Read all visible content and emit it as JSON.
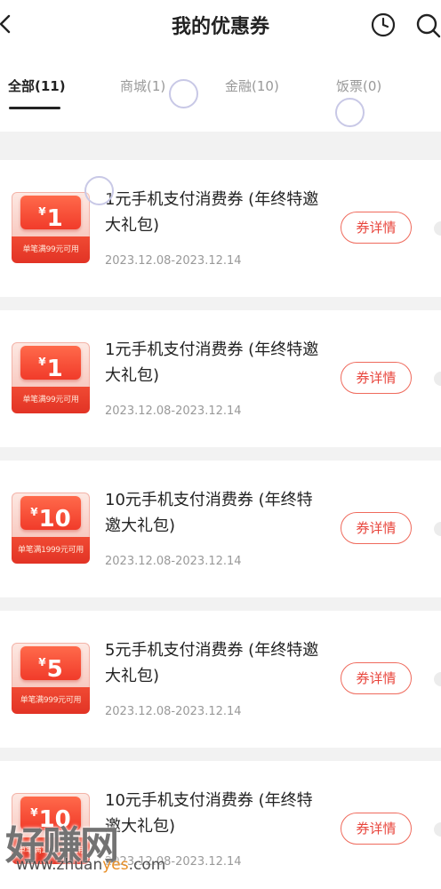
{
  "header": {
    "title": "我的优惠券",
    "back_icon": "chevron-left-icon",
    "history_icon": "clock-icon",
    "search_icon": "search-icon"
  },
  "tabs": [
    {
      "label": "全部(11)",
      "active": true
    },
    {
      "label": "商城(1)",
      "active": false
    },
    {
      "label": "金融(10)",
      "active": false
    },
    {
      "label": "饭票(0)",
      "active": false
    }
  ],
  "coupons": [
    {
      "amount": "1",
      "currency": "¥",
      "condition": "单笔满99元可用",
      "name": "1元手机支付消费券 (年终特邀大礼包)",
      "date": "2023.12.08-2023.12.14",
      "button": "券详情"
    },
    {
      "amount": "1",
      "currency": "¥",
      "condition": "单笔满99元可用",
      "name": "1元手机支付消费券 (年终特邀大礼包)",
      "date": "2023.12.08-2023.12.14",
      "button": "券详情"
    },
    {
      "amount": "10",
      "currency": "¥",
      "condition": "单笔满1999元可用",
      "name": "10元手机支付消费券 (年终特邀大礼包)",
      "date": "2023.12.08-2023.12.14",
      "button": "券详情"
    },
    {
      "amount": "5",
      "currency": "¥",
      "condition": "单笔满999元可用",
      "name": "5元手机支付消费券 (年终特邀大礼包)",
      "date": "2023.12.08-2023.12.14",
      "button": "券详情"
    },
    {
      "amount": "10",
      "currency": "¥",
      "condition": "单笔满1999元可用",
      "name": "10元手机支付消费券 (年终特邀大礼包)",
      "date": "2023.12.08-2023.12.14",
      "button": "券详情"
    }
  ],
  "watermark": {
    "logo_text": "好赚网",
    "url_prefix": "www.zhuan",
    "url_highlight": "yes",
    "url_suffix": ".com"
  },
  "colors": {
    "accent": "#e8453c",
    "badge_red": "#f13b2a",
    "badge_pink": "#fde8e2"
  }
}
